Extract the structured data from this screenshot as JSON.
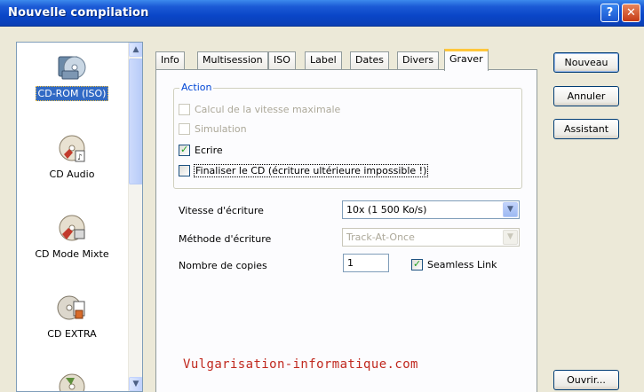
{
  "window": {
    "title": "Nouvelle compilation",
    "help_label": "?",
    "close_label": "✕"
  },
  "sidebar": {
    "items": [
      {
        "label": "CD-ROM (ISO)",
        "icon": "cd-rom-iso-icon",
        "selected": true
      },
      {
        "label": "CD Audio",
        "icon": "cd-audio-icon",
        "selected": false
      },
      {
        "label": "CD Mode Mixte",
        "icon": "cd-mixed-mode-icon",
        "selected": false
      },
      {
        "label": "CD EXTRA",
        "icon": "cd-extra-icon",
        "selected": false
      },
      {
        "label": "",
        "icon": "cd-partial-icon",
        "selected": false
      }
    ],
    "scroll_up": "▲",
    "scroll_down": "▼"
  },
  "tabs": [
    {
      "label": "Info",
      "active": false
    },
    {
      "label": "Multisession",
      "active": false
    },
    {
      "label": "ISO",
      "active": false
    },
    {
      "label": "Label",
      "active": false
    },
    {
      "label": "Dates",
      "active": false
    },
    {
      "label": "Divers",
      "active": false
    },
    {
      "label": "Graver",
      "active": true
    }
  ],
  "action": {
    "legend": "Action",
    "options": [
      {
        "label": "Calcul de la vitesse maximale",
        "checked": false,
        "disabled": true
      },
      {
        "label": "Simulation",
        "checked": false,
        "disabled": true
      },
      {
        "label": "Ecrire",
        "checked": true,
        "disabled": false
      },
      {
        "label": "Finaliser le CD (écriture ultérieure impossible !)",
        "checked": false,
        "disabled": false,
        "focused": true
      }
    ]
  },
  "settings": {
    "speed_label": "Vitesse d'écriture",
    "speed_value": "10x (1 500 Ko/s)",
    "method_label": "Méthode d'écriture",
    "method_value": "Track-At-Once",
    "copies_label": "Nombre de copies",
    "copies_value": "1",
    "seamless_label": "Seamless Link",
    "seamless_checked": true
  },
  "watermark": "Vulgarisation-informatique.com",
  "buttons": {
    "new": "Nouveau",
    "cancel": "Annuler",
    "wizard": "Assistant",
    "open": "Ouvrir..."
  },
  "colors": {
    "title_bar": "#0a46c8",
    "selection": "#316ac5",
    "watermark": "#c0281e",
    "active_tab_accent": "#ffc73c"
  }
}
